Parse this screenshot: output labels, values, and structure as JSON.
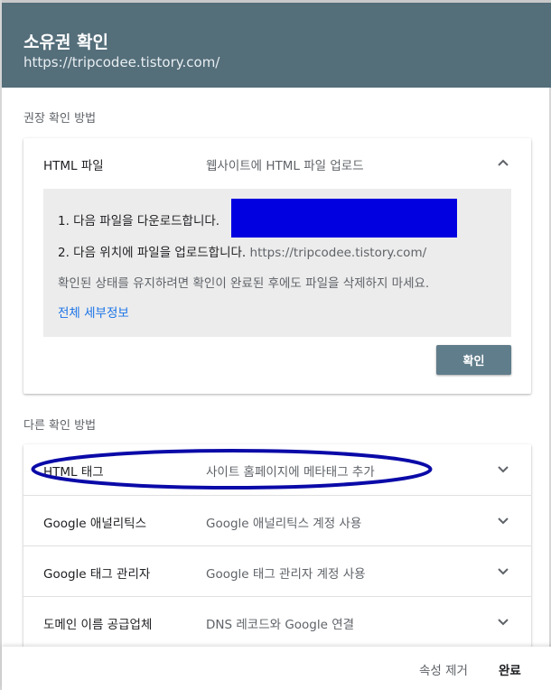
{
  "dialog": {
    "title": "소유권 확인",
    "site_url": "https://tripcodee.tistory.com/"
  },
  "recommended": {
    "label": "권장 확인 방법",
    "method": {
      "name": "HTML 파일",
      "description": "웹사이트에 HTML 파일 업로드",
      "expanded": true,
      "chevron": "chevron-up-icon"
    },
    "steps": {
      "step1": "1. 다음 파일을 다운로드합니다.",
      "step2_prefix": "2. 다음 위치에 파일을 업로드합니다.",
      "step2_url": "https://tripcodee.tistory.com/",
      "note": "확인된 상태를 유지하려면 확인이 완료된 후에도 파일을 삭제하지 마세요.",
      "details_link": "전체 세부정보",
      "redaction_color": "#0000e0"
    },
    "confirm_button": "확인"
  },
  "other": {
    "label": "다른 확인 방법",
    "methods": [
      {
        "name": "HTML 태그",
        "description": "사이트 홈페이지에 메타태그 추가",
        "chevron": "chevron-down-icon"
      },
      {
        "name": "Google 애널리틱스",
        "description": "Google 애널리틱스 계정 사용",
        "chevron": "chevron-down-icon"
      },
      {
        "name": "Google 태그 관리자",
        "description": "Google 태그 관리자 계정 사용",
        "chevron": "chevron-down-icon"
      },
      {
        "name": "도메인 이름 공급업체",
        "description": "DNS 레코드와 Google 연결",
        "chevron": "chevron-down-icon"
      }
    ],
    "highlight_color": "#0a0aa8"
  },
  "footer": {
    "remove_label": "속성 제거",
    "done_label": "완료"
  },
  "colors": {
    "header_bg": "#546e7a",
    "button_bg": "#607d8b",
    "link": "#1a73e8"
  }
}
